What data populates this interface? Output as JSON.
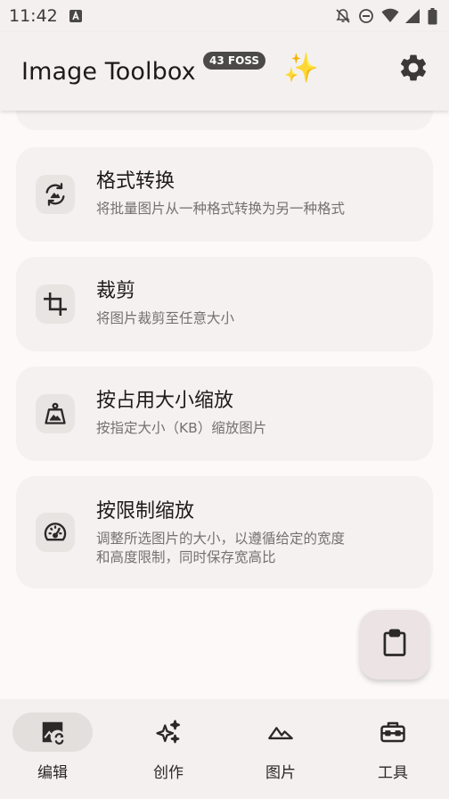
{
  "status_bar": {
    "time": "11:42"
  },
  "app_bar": {
    "title": "Image Toolbox",
    "version_badge": "43 FOSS",
    "sparkle": "✨"
  },
  "tools": [
    {
      "title": "格式转换",
      "description": "将批量图片从一种格式转换为另一种格式",
      "icon": "format-convert-icon"
    },
    {
      "title": "裁剪",
      "description": "将图片裁剪至任意大小",
      "icon": "crop-icon"
    },
    {
      "title": "按占用大小缩放",
      "description": "按指定大小（KB）缩放图片",
      "icon": "weight-icon"
    },
    {
      "title": "按限制缩放",
      "description_line1": "调整所选图片的大小，以遵循给定的宽度",
      "description_line2": "和高度限制，同时保存宽高比",
      "icon": "speedometer-icon"
    }
  ],
  "bottom_nav": [
    {
      "label": "编辑",
      "icon": "image-edit-icon",
      "selected": true
    },
    {
      "label": "创作",
      "icon": "sparkles-icon",
      "selected": false
    },
    {
      "label": "图片",
      "icon": "landscape-icon",
      "selected": false
    },
    {
      "label": "工具",
      "icon": "toolbox-icon",
      "selected": false
    }
  ],
  "colors": {
    "background": "#fcf9f8",
    "surface": "#f3f0ef",
    "card": "#f4f1f0",
    "badge": "#4b4a49"
  }
}
